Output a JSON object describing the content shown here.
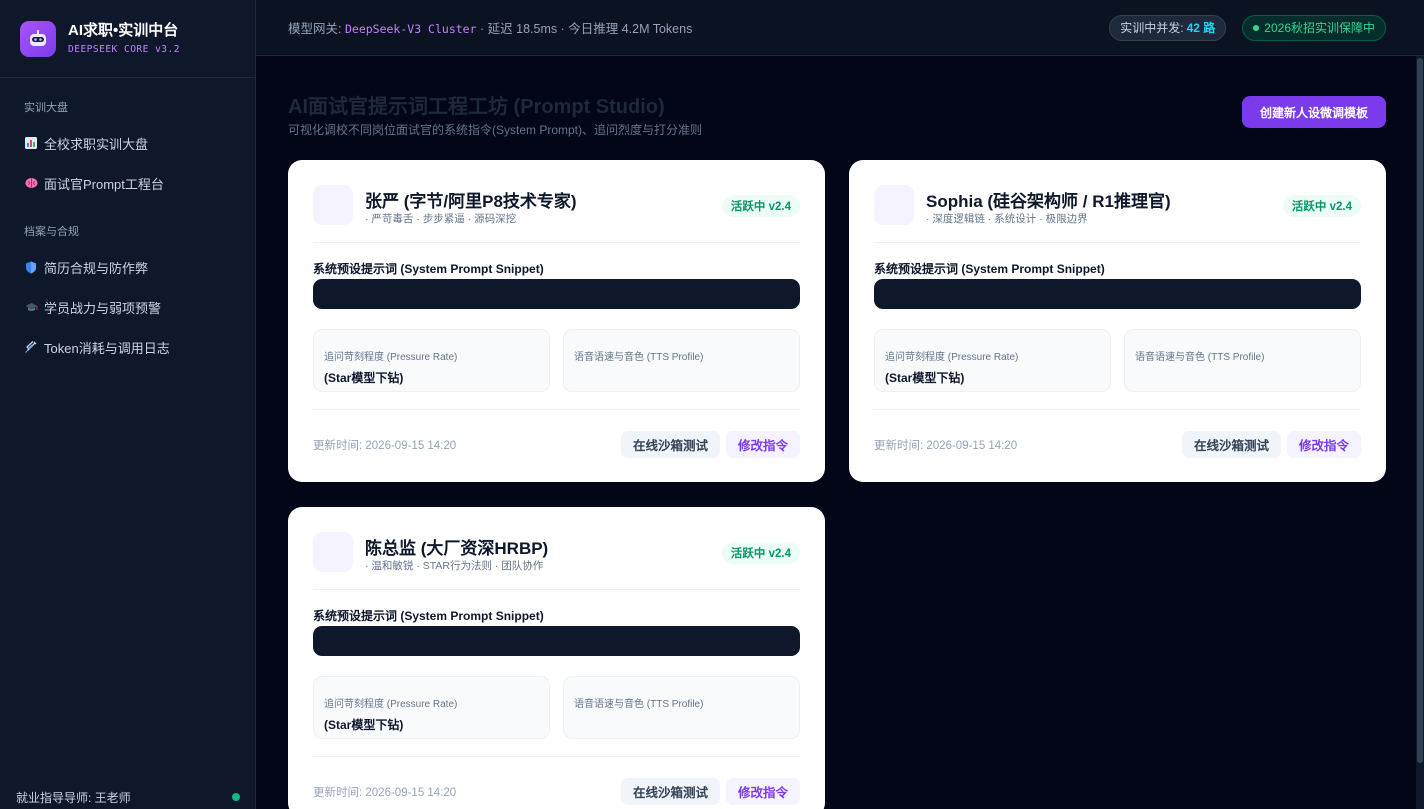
{
  "sidebar": {
    "brand_title": "AI求职•实训中台",
    "brand_sub": "DEEPSEEK CORE v3.2",
    "logo_icon": "robot-icon",
    "sections": [
      {
        "label": "实训大盘",
        "items": [
          {
            "label": "全校求职实训大盘",
            "icon": "bar-chart-icon"
          },
          {
            "label": "面试官Prompt工程台",
            "icon": "brain-icon"
          }
        ]
      },
      {
        "label": "档案与合规",
        "items": [
          {
            "label": "简历合规与防作弊",
            "icon": "shield-icon"
          },
          {
            "label": "学员战力与弱项预警",
            "icon": "graduation-cap-icon"
          },
          {
            "label": "Token消耗与调用日志",
            "icon": "syringe-icon"
          }
        ]
      }
    ],
    "footer_label": "就业指导导师: 王老师"
  },
  "header": {
    "gateway_prefix": "模型网关:",
    "gateway_model": "DeepSeek-V3 Cluster",
    "gateway_suffix": "· 延迟 18.5ms · 今日推理 4.2M Tokens",
    "concurrency_label": "实训中并发:",
    "concurrency_value": "42 路",
    "status_label": "2026秋招实训保障中"
  },
  "page": {
    "title": "AI面试官提示词工程工坊 (Prompt Studio)",
    "subtitle": "可视化调校不同岗位面试官的系统指令(System Prompt)、追问烈度与打分准则",
    "create_button": "创建新人设微调模板"
  },
  "cards": [
    {
      "name": "张严 (字节/阿里P8技术专家)",
      "tags": "· 严苛毒舌 · 步步紧逼 · 源码深挖",
      "status": "活跃中 v2.4",
      "prompt_label": "系统预设提示词 (System Prompt Snippet)",
      "pressure_label": "追问苛刻程度 (Pressure Rate)",
      "pressure_value": "(Star模型下钻)",
      "tts_label": "语音语速与音色 (TTS Profile)",
      "updated": "更新时间: 2026-09-15 14:20",
      "sandbox_button": "在线沙箱测试",
      "edit_button": "修改指令"
    },
    {
      "name": "Sophia (硅谷架构师 / R1推理官)",
      "tags": "· 深度逻辑链 · 系统设计 · 极限边界",
      "status": "活跃中 v2.4",
      "prompt_label": "系统预设提示词 (System Prompt Snippet)",
      "pressure_label": "追问苛刻程度 (Pressure Rate)",
      "pressure_value": "(Star模型下钻)",
      "tts_label": "语音语速与音色 (TTS Profile)",
      "updated": "更新时间: 2026-09-15 14:20",
      "sandbox_button": "在线沙箱测试",
      "edit_button": "修改指令"
    },
    {
      "name": "陈总监 (大厂资深HRBP)",
      "tags": "· 温和敏锐 · STAR行为法则 · 团队协作",
      "status": "活跃中 v2.4",
      "prompt_label": "系统预设提示词 (System Prompt Snippet)",
      "pressure_label": "追问苛刻程度 (Pressure Rate)",
      "pressure_value": "(Star模型下钻)",
      "tts_label": "语音语速与音色 (TTS Profile)",
      "updated": "更新时间: 2026-09-15 14:20",
      "sandbox_button": "在线沙箱测试",
      "edit_button": "修改指令"
    }
  ],
  "colors": {
    "accent": "#7c3aed",
    "status_green": "#059669",
    "concurrency_cyan": "#22d3ee"
  }
}
